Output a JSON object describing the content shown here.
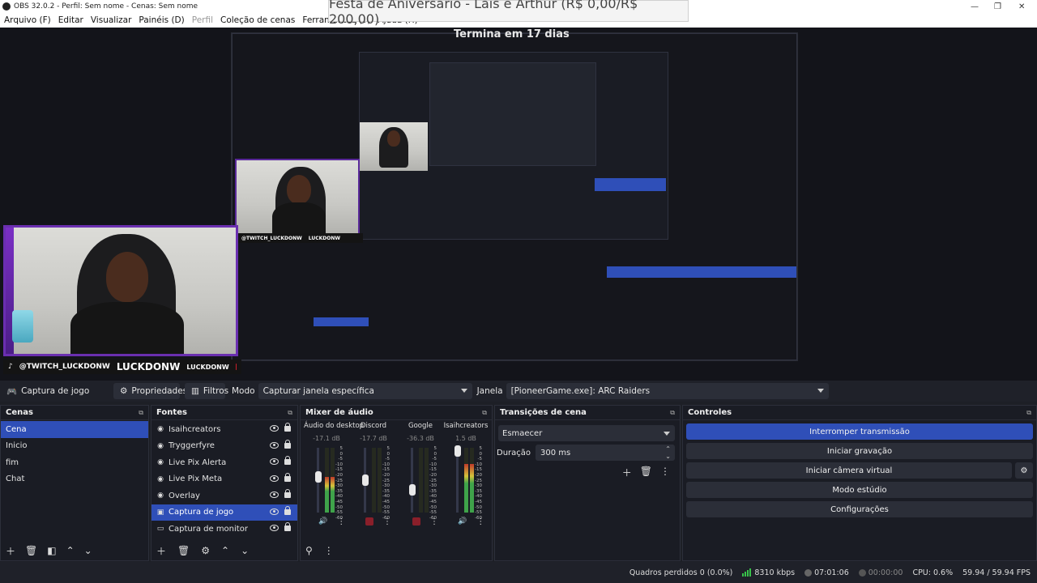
{
  "window": {
    "title": "OBS 32.0.2 - Perfil: Sem nome - Cenas: Sem nome",
    "controls": [
      "—",
      "❐",
      "✕"
    ]
  },
  "menu": [
    "Arquivo (F)",
    "Editar",
    "Visualizar",
    "Painéis (D)",
    "Perfil",
    "Coleção de cenas",
    "Ferramentas (T)",
    "Ajuda (H)"
  ],
  "overlay": {
    "goal_banner": "Festa de Aniversario - Lais e Arthur (R$ 0,00/R$ 200,00)",
    "countdown": "Termina em 17 dias"
  },
  "preview": {
    "cam_handle": "@TWITCH_LUCKDONW",
    "cam_brand": "LUCKDONW",
    "cam_brand2": "LUCKDONW"
  },
  "source_toolbar": {
    "source_name": "Captura de jogo",
    "properties": "Propriedades",
    "filters": "Filtros",
    "mode_label": "Modo",
    "mode_value": "Capturar janela específica",
    "window_label": "Janela",
    "window_value": "[PioneerGame.exe]: ARC Raiders"
  },
  "scenes": {
    "title": "Cenas",
    "items": [
      "Cena",
      "Inicio",
      "fim",
      "Chat"
    ],
    "selected": 0
  },
  "sources": {
    "title": "Fontes",
    "items": [
      {
        "name": "Isaihcreators",
        "icon": "browser-icon"
      },
      {
        "name": "Tryggerfyre",
        "icon": "browser-icon"
      },
      {
        "name": "Live Pix Alerta",
        "icon": "browser-icon"
      },
      {
        "name": "Live Pix Meta",
        "icon": "browser-icon"
      },
      {
        "name": "Overlay",
        "icon": "browser-icon"
      },
      {
        "name": "Captura de jogo",
        "icon": "gamepad-icon"
      },
      {
        "name": "Captura de monitor",
        "icon": "monitor-icon"
      }
    ],
    "selected": 5
  },
  "mixer": {
    "title": "Mixer de áudio",
    "channels": [
      {
        "name": "Áudio do desktop",
        "db": "-17.1 dB",
        "level": 0.55,
        "fader": 0.55,
        "muted": false
      },
      {
        "name": "Discord",
        "db": "-17.7 dB",
        "level": 0.0,
        "fader": 0.5,
        "muted": true
      },
      {
        "name": "Google",
        "db": "-36.3 dB",
        "level": 0.0,
        "fader": 0.35,
        "muted": true
      },
      {
        "name": "Isaihcreators",
        "db": "1.5 dB",
        "level": 0.75,
        "fader": 0.95,
        "muted": false
      }
    ],
    "scale": [
      "5",
      "0",
      "-5",
      "-10",
      "-15",
      "-20",
      "-25",
      "-30",
      "-35",
      "-40",
      "-45",
      "-50",
      "-55",
      "-60"
    ]
  },
  "transitions": {
    "title": "Transições de cena",
    "type": "Esmaecer",
    "duration_label": "Duração",
    "duration_value": "300 ms"
  },
  "controls": {
    "title": "Controles",
    "stream": "Interromper transmissão",
    "record": "Iniciar gravação",
    "virtualcam": "Iniciar câmera virtual",
    "studio": "Modo estúdio",
    "settings": "Configurações"
  },
  "status": {
    "dropped": "Quadros perdidos 0 (0.0%)",
    "bitrate": "8310 kbps",
    "stream_time": "07:01:06",
    "rec_time": "00:00:00",
    "cpu": "CPU: 0.6%",
    "fps": "59.94 / 59.94 FPS"
  },
  "colors": {
    "accent": "#2f4fb8",
    "bg": "#1d1f26",
    "panel": "#1a1c24",
    "live_green": "#38c24a",
    "mute_red": "#8a1f2a"
  }
}
